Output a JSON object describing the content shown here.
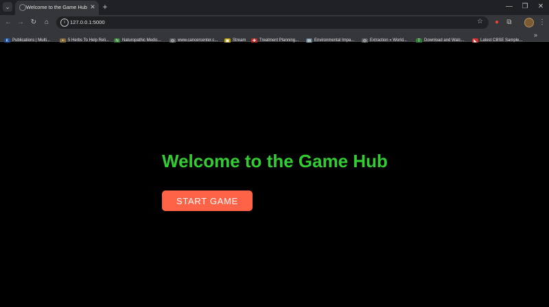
{
  "browser": {
    "tab": {
      "title": "Welcome to the Game Hub",
      "close_glyph": "✕",
      "favicon": "globe-icon"
    },
    "new_tab_glyph": "+",
    "tab_menu_glyph": "⌄",
    "window_controls": {
      "minimize": "—",
      "restore": "❐",
      "close": "✕"
    },
    "nav": {
      "back": "←",
      "forward": "→",
      "reload": "↻",
      "home": "⌂"
    },
    "url": "127.0.0.1:5000",
    "site_info_glyph": "i",
    "star_glyph": "☆",
    "toolbar_icons": {
      "extension_red": "●",
      "puzzle": "⧉",
      "menu": "⋮"
    },
    "bookmarks": [
      {
        "label": "Publications | Multi...",
        "icon": "k-favicon",
        "color": "#1a4fa0",
        "glyph": "K"
      },
      {
        "label": "5 Herbs To Help Reli...",
        "icon": "dots-favicon",
        "color": "#8a6d3b",
        "glyph": "•"
      },
      {
        "label": "Naturopathic Medic...",
        "icon": "naturopathic-favicon",
        "color": "#2e7d32",
        "glyph": "N"
      },
      {
        "label": "www.cancercenter.c...",
        "icon": "globe-icon",
        "color": "#5f6368",
        "glyph": "◎"
      },
      {
        "label": "Stream",
        "icon": "stream-favicon",
        "color": "#c0a000",
        "glyph": "▣"
      },
      {
        "label": "Treatment Planning...",
        "icon": "treatment-favicon",
        "color": "#c62828",
        "glyph": "✚"
      },
      {
        "label": "Environmental Impa...",
        "icon": "document-favicon",
        "color": "#607d8b",
        "glyph": "▤"
      },
      {
        "label": "Extraction « World...",
        "icon": "globe-icon",
        "color": "#5f6368",
        "glyph": "◎"
      },
      {
        "label": "Download and Watc...",
        "icon": "tb-favicon",
        "color": "#2e7d32",
        "glyph": "T"
      },
      {
        "label": "Latest CBSE Sample...",
        "icon": "flag-favicon",
        "color": "#d32f2f",
        "glyph": "◣"
      }
    ],
    "bookmarks_more": "»"
  },
  "page": {
    "heading": "Welcome to the Game Hub",
    "start_button": "Start Game",
    "colors": {
      "background": "#000000",
      "heading": "#32cd32",
      "button": "#ff6347",
      "button_text": "#ffffff"
    }
  }
}
